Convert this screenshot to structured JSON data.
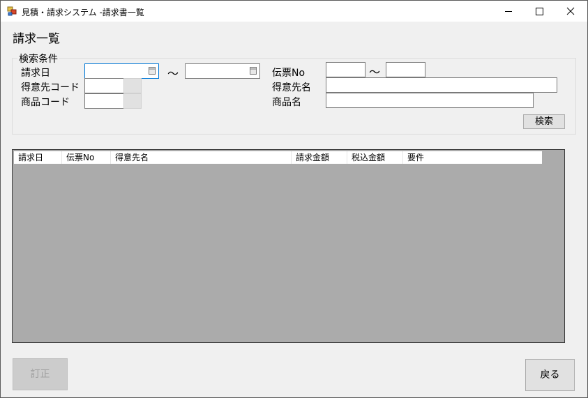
{
  "window": {
    "title": "見積・請求システム -請求書一覧"
  },
  "page": {
    "title": "請求一覧"
  },
  "search": {
    "legend": "検索条件",
    "invoice_date_label": "請求日",
    "invoice_date_from": "",
    "invoice_date_to": "",
    "range_sep": "～",
    "customer_code_label": "得意先コード",
    "customer_code": "",
    "product_code_label": "商品コード",
    "product_code": "",
    "slip_no_label": "伝票No",
    "slip_no_from": "",
    "slip_no_to": "",
    "customer_name_label": "得意先名",
    "customer_name": "",
    "product_name_label": "商品名",
    "product_name": "",
    "search_button": "検索"
  },
  "grid": {
    "columns": [
      "請求日",
      "伝票No",
      "得意先名",
      "請求金額",
      "税込金額",
      "要件"
    ],
    "rows": []
  },
  "footer": {
    "correct_button": "訂正",
    "back_button": "戻る"
  },
  "colors": {
    "focus_border": "#0078d7",
    "grid_background": "#ababab",
    "disabled_button": "#cccccc"
  }
}
